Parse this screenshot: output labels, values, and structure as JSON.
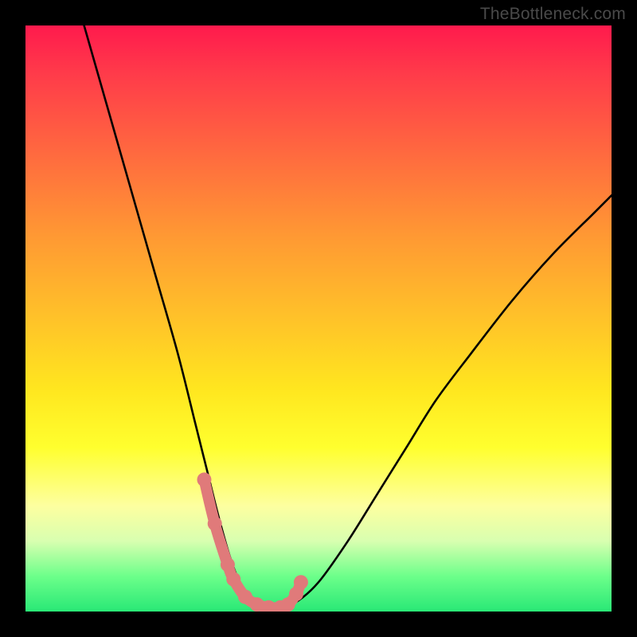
{
  "watermark": "TheBottleneck.com",
  "colors": {
    "background": "#000000",
    "curve": "#000000",
    "marker": "#e07a7a",
    "gradient_stops": [
      "#ff1a4d",
      "#ff3a4a",
      "#ff6a3f",
      "#ff9933",
      "#ffc229",
      "#ffe61f",
      "#ffff2e",
      "#fdffa0",
      "#d8ffb0",
      "#6cff8a",
      "#29e876"
    ]
  },
  "chart_data": {
    "type": "line",
    "title": "",
    "xlabel": "",
    "ylabel": "",
    "xlim": [
      0,
      100
    ],
    "ylim": [
      0,
      100
    ],
    "grid": false,
    "legend": false,
    "series": [
      {
        "name": "bottleneck-curve",
        "x": [
          10,
          14,
          18,
          22,
          26,
          29,
          31,
          33,
          35,
          37,
          39,
          41,
          43,
          46,
          50,
          55,
          60,
          65,
          70,
          76,
          83,
          90,
          97,
          100
        ],
        "y": [
          100,
          86,
          72,
          58,
          44,
          32,
          24,
          16,
          9,
          4,
          1.5,
          0.7,
          0.7,
          1.5,
          5,
          12,
          20,
          28,
          36,
          44,
          53,
          61,
          68,
          71
        ]
      }
    ],
    "markers": {
      "name": "highlight-points",
      "x": [
        30.5,
        32.3,
        34.5,
        35.5,
        37.5,
        39.5,
        41.5,
        43.5,
        44.8,
        46.2,
        47.0
      ],
      "y": [
        22.5,
        15.0,
        8.0,
        5.5,
        2.5,
        1.2,
        0.7,
        0.7,
        1.2,
        3.0,
        5.0
      ]
    }
  }
}
